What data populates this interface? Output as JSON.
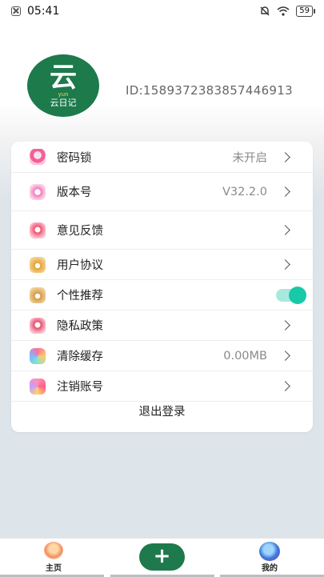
{
  "statusbar": {
    "time": "05:41",
    "battery": "59"
  },
  "profile": {
    "logo_char": "云",
    "logo_sub": "yun",
    "logo_name": "云日记",
    "user_id": "ID:1589372383857446913"
  },
  "settings": {
    "items": [
      {
        "label": "密码锁",
        "value": "未开启",
        "icon": "lock-icon"
      },
      {
        "label": "版本号",
        "value": "V32.2.0",
        "icon": "version-icon"
      },
      {
        "label": "意见反馈",
        "value": "",
        "icon": "feedback-icon"
      },
      {
        "label": "用户协议",
        "value": "",
        "icon": "agreement-icon"
      },
      {
        "label": "个性推荐",
        "value": "",
        "icon": "recommend-icon",
        "toggle_on": true
      },
      {
        "label": "隐私政策",
        "value": "",
        "icon": "privacy-icon"
      },
      {
        "label": "清除缓存",
        "value": "0.00MB",
        "icon": "clear-cache-icon"
      },
      {
        "label": "注销账号",
        "value": "",
        "icon": "delete-account-icon"
      }
    ],
    "logout": "退出登录"
  },
  "bottom_nav": {
    "home": "主页",
    "add": "+",
    "mine": "我的"
  },
  "colors": {
    "accent": "#1e7a4c",
    "toggle": "#17c9a8"
  }
}
